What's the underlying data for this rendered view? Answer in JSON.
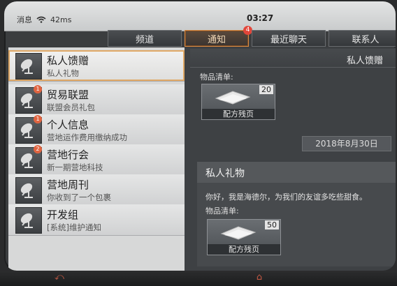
{
  "status": {
    "carrier": "消息",
    "speed": "42ms",
    "time": "03:27"
  },
  "tabs": [
    {
      "label": "频道",
      "active": false
    },
    {
      "label": "通知",
      "active": true,
      "badge": "4"
    },
    {
      "label": "最近聊天",
      "active": false
    },
    {
      "label": "联系人",
      "active": false
    }
  ],
  "list": [
    {
      "title": "私人馈赠",
      "subtitle": "私人礼物",
      "selected": true,
      "badge": ""
    },
    {
      "title": "贸易联盟",
      "subtitle": "联盟会员礼包",
      "selected": false,
      "badge": "1"
    },
    {
      "title": "个人信息",
      "subtitle": "营地运作费用缴纳成功",
      "selected": false,
      "badge": "1"
    },
    {
      "title": "营地行会",
      "subtitle": "新一期营地科技",
      "selected": false,
      "badge": "2"
    },
    {
      "title": "营地周刊",
      "subtitle": "你收到了一个包裹",
      "selected": false,
      "badge": ""
    },
    {
      "title": "开发组",
      "subtitle": "[系统]维护通知",
      "selected": false,
      "badge": ""
    }
  ],
  "detail": {
    "header": "私人馈赠",
    "items_label": "物品清单:",
    "item1": {
      "name": "配方残页",
      "qty": "20"
    },
    "date": "2018年8月30日",
    "card": {
      "title": "私人礼物",
      "message": "你好，我是海德尔，为我们的友谊多吃些甜食。",
      "items_label": "物品清单:",
      "item": {
        "name": "配方残页",
        "qty": "50"
      }
    }
  },
  "colors": {
    "accent": "#d98b45",
    "badge": "#e2463a"
  }
}
